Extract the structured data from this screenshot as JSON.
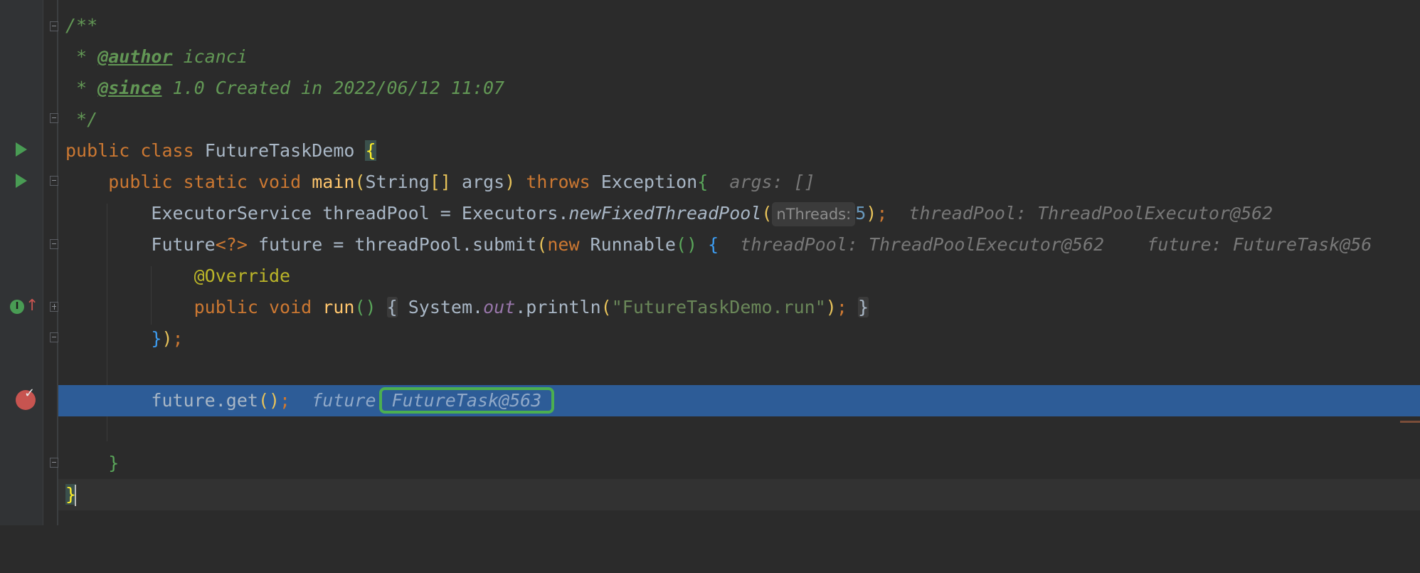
{
  "editor": {
    "lines": {
      "l1": {
        "c1": "/**"
      },
      "l2": {
        "c1": " * ",
        "tag": "@author",
        "c2": " icanci"
      },
      "l3": {
        "c1": " * ",
        "tag": "@since",
        "c2": " 1.0 Created in 2022/06/12 11:07"
      },
      "l4": {
        "c1": " */"
      },
      "l5": {
        "kw1": "public",
        "kw2": "class",
        "name": "FutureTaskDemo",
        "brace": "{"
      },
      "l6": {
        "kw1": "public",
        "kw2": "static",
        "kw3": "void",
        "fn": "main",
        "p1": "(",
        "type": "String",
        "br": "[]",
        "arg": " args",
        "p2": ")",
        "kw4": "throws",
        "exc": "Exception",
        "brace": "{",
        "hint": "args: []"
      },
      "l7": {
        "t1": "ExecutorService threadPool = Executors.",
        "method": "newFixedThreadPool",
        "p1": "(",
        "param_hint": "nThreads:",
        "num": "5",
        "p2": ")",
        "semi": ";",
        "hint": "threadPool: ThreadPoolExecutor@562"
      },
      "l8": {
        "t1": "Future",
        "gen": "<?>",
        "t2": " future = threadPool.submit",
        "p1": "(",
        "kw": "new",
        "t3": " Runnable",
        "p2": "()",
        "brace": "{",
        "hint1": "threadPool: ThreadPoolExecutor@562",
        "hint2": "future: FutureTask@56"
      },
      "l9": {
        "ann": "@Override"
      },
      "l10": {
        "kw1": "public",
        "kw2": "void",
        "fn": "run",
        "p": "()",
        "b1": "{",
        "t1": " System.",
        "field": "out",
        "t2": ".println",
        "p1": "(",
        "str": "\"FutureTaskDemo.run\"",
        "p2": ")",
        "semi": ";",
        "b2": "}"
      },
      "l11": {
        "brace": "}",
        "paren": ")",
        "semi": ";"
      },
      "l13": {
        "t1": "future.get",
        "p": "()",
        "semi": ";",
        "hint_name": "future",
        "hint_value": "FutureTask@563"
      },
      "l15": {
        "brace": "}"
      },
      "l16": {
        "brace": "}"
      }
    }
  },
  "colors": {
    "background": "#2b2b2b",
    "execution_line": "#2d5c97",
    "keyword": "#cc7832",
    "method": "#ffc66d",
    "string": "#6a8759",
    "comment": "#629755",
    "highlight_box": "#4caf50"
  },
  "gutter_icons": {
    "l5": "run-icon",
    "l6": "run-icon",
    "l10": "implements-icon",
    "l13": "breakpoint-icon"
  }
}
